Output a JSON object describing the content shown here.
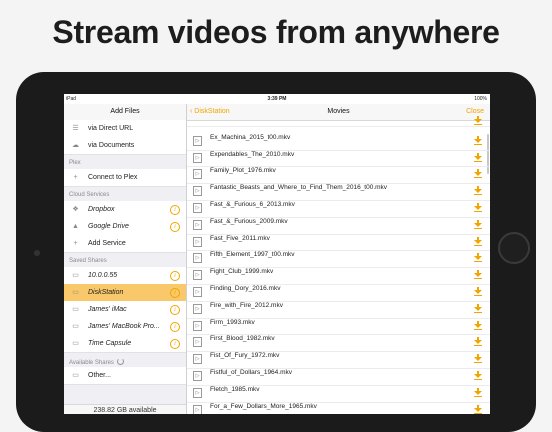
{
  "headline": "Stream videos from anywhere",
  "status": {
    "carrier": "iPad",
    "time": "3:39 PM",
    "battery": "100%"
  },
  "left": {
    "title": "Add Files",
    "rows_top": [
      {
        "label": "via Direct URL",
        "icon": "link-icon",
        "glyph": "☰"
      },
      {
        "label": "via Documents",
        "icon": "cloud-icon",
        "glyph": "☁"
      }
    ],
    "sec_plex": "Plex",
    "plex_rows": [
      {
        "label": "Connect to Plex",
        "glyph": "+"
      }
    ],
    "sec_cloud": "Cloud Services",
    "cloud_rows": [
      {
        "label": "Dropbox",
        "glyph": "❖",
        "info": "i"
      },
      {
        "label": "Google Drive",
        "glyph": "▲",
        "info": "i"
      },
      {
        "label": "Add Service",
        "glyph": "+"
      }
    ],
    "sec_saved": "Saved Shares",
    "saved_rows": [
      {
        "label": "10.0.0.55",
        "glyph": "▭",
        "info": "i"
      },
      {
        "label": "DiskStation",
        "glyph": "▭",
        "info": "i"
      },
      {
        "label": "James' iMac",
        "glyph": "▭",
        "info": "i"
      },
      {
        "label": "James' MacBook Pro...",
        "glyph": "▭",
        "info": "i"
      },
      {
        "label": "Time Capsule",
        "glyph": "▭",
        "info": "i"
      }
    ],
    "sec_available": "Available Shares",
    "available_rows": [
      {
        "label": "Other...",
        "glyph": "▭"
      }
    ],
    "available_space": "238.82 GB available"
  },
  "right": {
    "back": "DiskStation",
    "title": "Movies",
    "close": "Close",
    "files": [
      {
        "name": "",
        "size": ""
      },
      {
        "name": "Ex_Machina_2015_t00.mkv",
        "size": ""
      },
      {
        "name": "Expendables_The_2010.mkv",
        "size": ""
      },
      {
        "name": "Family_Plot_1976.mkv",
        "size": ""
      },
      {
        "name": "Fantastic_Beasts_and_Where_to_Find_Them_2016_t00.mkv",
        "size": ""
      },
      {
        "name": "Fast_&_Furious_6_2013.mkv",
        "size": ""
      },
      {
        "name": "Fast_&_Furious_2009.mkv",
        "size": ""
      },
      {
        "name": "Fast_Five_2011.mkv",
        "size": ""
      },
      {
        "name": "Fifth_Element_1997_t00.mkv",
        "size": ""
      },
      {
        "name": "Fight_Club_1999.mkv",
        "size": ""
      },
      {
        "name": "Finding_Dory_2016.mkv",
        "size": ""
      },
      {
        "name": "Fire_with_Fire_2012.mkv",
        "size": ""
      },
      {
        "name": "Firm_1993.mkv",
        "size": ""
      },
      {
        "name": "First_Blood_1982.mkv",
        "size": ""
      },
      {
        "name": "Fist_Of_Fury_1972.mkv",
        "size": ""
      },
      {
        "name": "Fistful_of_Dollars_1964.mkv",
        "size": ""
      },
      {
        "name": "Fletch_1985.mkv",
        "size": ""
      },
      {
        "name": "For_a_Few_Dollars_More_1965.mkv",
        "size": ""
      }
    ]
  },
  "colors": {
    "accent": "#f0a500",
    "selected": "#f9c86a"
  }
}
